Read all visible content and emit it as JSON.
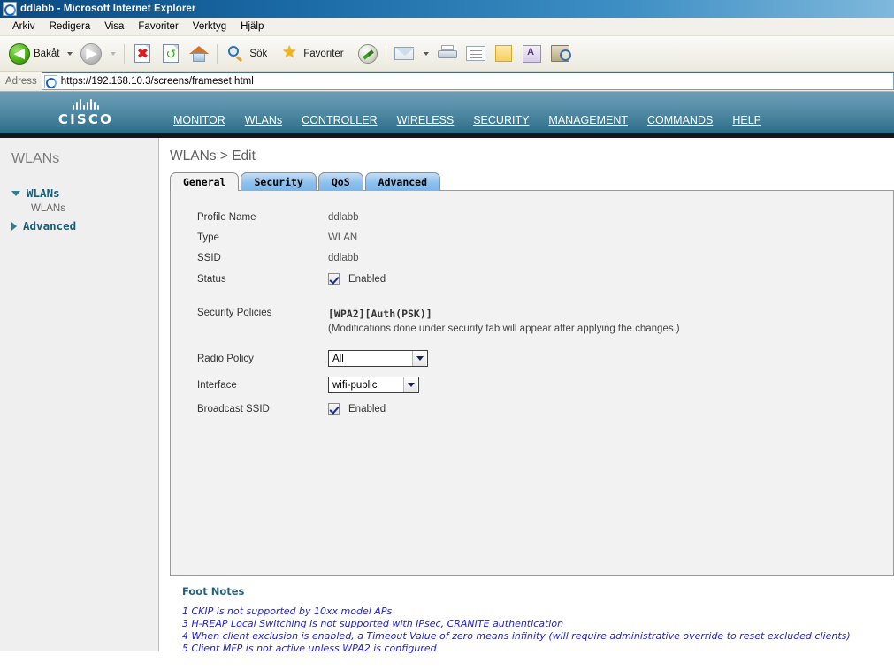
{
  "window": {
    "title": "ddlabb - Microsoft Internet Explorer",
    "icon": "ie-document-icon"
  },
  "menubar": {
    "items": [
      {
        "label": "Arkiv",
        "name": "menu-arkiv"
      },
      {
        "label": "Redigera",
        "name": "menu-redigera"
      },
      {
        "label": "Visa",
        "name": "menu-visa"
      },
      {
        "label": "Favoriter",
        "name": "menu-favoriter"
      },
      {
        "label": "Verktyg",
        "name": "menu-verktyg"
      },
      {
        "label": "Hjälp",
        "name": "menu-hjalp"
      }
    ]
  },
  "toolbar": {
    "back_label": "Bakåt",
    "search_label": "Sök",
    "favorites_label": "Favoriter",
    "icons": [
      "back-icon",
      "forward-icon",
      "stop-icon",
      "refresh-icon",
      "home-icon",
      "search-icon",
      "favorites-star-icon",
      "history-icon",
      "mail-icon",
      "print-icon",
      "edit-icon",
      "notes-icon",
      "messenger-icon",
      "research-icon"
    ]
  },
  "address": {
    "label": "Adress",
    "url": "https://192.168.10.3/screens/frameset.html",
    "icon": "page-favicon"
  },
  "header": {
    "brand": "CISCO",
    "nav": [
      {
        "label": "MONITOR",
        "name": "nav-monitor",
        "active": false
      },
      {
        "label": "WLANs",
        "name": "nav-wlans",
        "active": true
      },
      {
        "label": "CONTROLLER",
        "name": "nav-controller",
        "active": false
      },
      {
        "label": "WIRELESS",
        "name": "nav-wireless",
        "active": false
      },
      {
        "label": "SECURITY",
        "name": "nav-security",
        "active": false
      },
      {
        "label": "MANAGEMENT",
        "name": "nav-management",
        "active": false
      },
      {
        "label": "COMMANDS",
        "name": "nav-commands",
        "active": false
      },
      {
        "label": "HELP",
        "name": "nav-help",
        "active": false
      }
    ],
    "accent_color": "#f0901e"
  },
  "sidebar": {
    "title": "WLANs",
    "groups": [
      {
        "label": "WLANs",
        "expanded": true,
        "children": [
          "WLANs"
        ]
      },
      {
        "label": "Advanced",
        "expanded": false,
        "children": []
      }
    ]
  },
  "main": {
    "breadcrumb": "WLANs > Edit",
    "tabs": [
      {
        "label": "General",
        "name": "tab-general",
        "active": true
      },
      {
        "label": "Security",
        "name": "tab-security",
        "active": false
      },
      {
        "label": "QoS",
        "name": "tab-qos",
        "active": false
      },
      {
        "label": "Advanced",
        "name": "tab-advanced",
        "active": false
      }
    ],
    "fields": {
      "profile_name_label": "Profile Name",
      "profile_name_value": "ddlabb",
      "type_label": "Type",
      "type_value": "WLAN",
      "ssid_label": "SSID",
      "ssid_value": "ddlabb",
      "status_label": "Status",
      "status_checked": true,
      "status_value": "Enabled",
      "security_policies_label": "Security Policies",
      "security_policies_value": "[WPA2][Auth(PSK)]",
      "security_policies_note": "(Modifications done under security tab will appear after applying the changes.)",
      "radio_policy_label": "Radio Policy",
      "radio_policy_value": "All",
      "interface_label": "Interface",
      "interface_value": "wifi-public",
      "broadcast_ssid_label": "Broadcast SSID",
      "broadcast_ssid_checked": true,
      "broadcast_ssid_value": "Enabled"
    },
    "footnotes": {
      "title": "Foot Notes",
      "lines": [
        "1 CKIP is not supported by 10xx model APs",
        "3 H-REAP Local Switching is not supported with IPsec, CRANITE authentication",
        "4 When client exclusion is enabled, a Timeout Value of zero means infinity (will require administrative override to reset excluded clients)",
        "5 Client MFP is not active unless WPA2 is configured"
      ]
    }
  }
}
